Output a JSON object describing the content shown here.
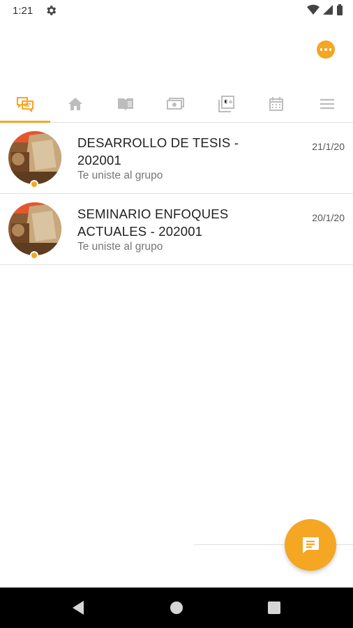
{
  "status_bar": {
    "time": "1:21"
  },
  "tabs": [
    {
      "name": "chats",
      "icon": "chat-icon",
      "active": true
    },
    {
      "name": "home",
      "icon": "home-icon",
      "active": false
    },
    {
      "name": "courses",
      "icon": "book-icon",
      "active": false
    },
    {
      "name": "payments",
      "icon": "money-icon",
      "active": false
    },
    {
      "name": "grades",
      "icon": "grades-icon",
      "active": false
    },
    {
      "name": "calendar",
      "icon": "calendar-icon",
      "active": false
    },
    {
      "name": "menu",
      "icon": "menu-icon",
      "active": false
    }
  ],
  "chats": [
    {
      "title": "DESARROLLO DE TESIS - 202001",
      "subtitle": "Te uniste al grupo",
      "date": "21/1/20"
    },
    {
      "title": "SEMINARIO ENFOQUES ACTUALES - 202001",
      "subtitle": "Te uniste al grupo",
      "date": "20/1/20"
    }
  ],
  "colors": {
    "accent": "#f5a623",
    "inactive_icon": "#bdbdbd",
    "divider": "#e0e0e0"
  }
}
